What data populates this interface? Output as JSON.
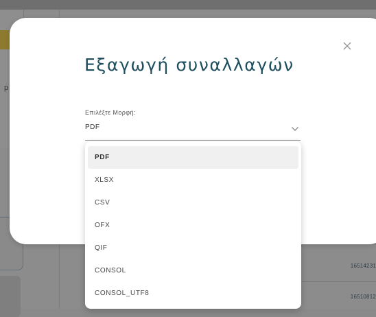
{
  "background": {
    "left_letter": "p",
    "row_numbers": [
      "16514231",
      "16510812"
    ]
  },
  "modal": {
    "title": "Εξαγωγή συναλλαγών",
    "close_icon": "close-icon",
    "format_select": {
      "label": "Επιλέξτε Μορφή:",
      "value": "PDF",
      "chevron_icon": "chevron-down-icon"
    }
  },
  "dropdown": {
    "options": [
      {
        "label": "PDF",
        "selected": true
      },
      {
        "label": "XLSX",
        "selected": false
      },
      {
        "label": "CSV",
        "selected": false
      },
      {
        "label": "OFX",
        "selected": false
      },
      {
        "label": "QIF",
        "selected": false
      },
      {
        "label": "CONSOL",
        "selected": false
      },
      {
        "label": "CONSOL_UTF8",
        "selected": false
      }
    ]
  },
  "colors": {
    "title": "#1f4f5e",
    "overlay": "#8c8c8c",
    "selected_option_bg": "#f0f0f0"
  }
}
